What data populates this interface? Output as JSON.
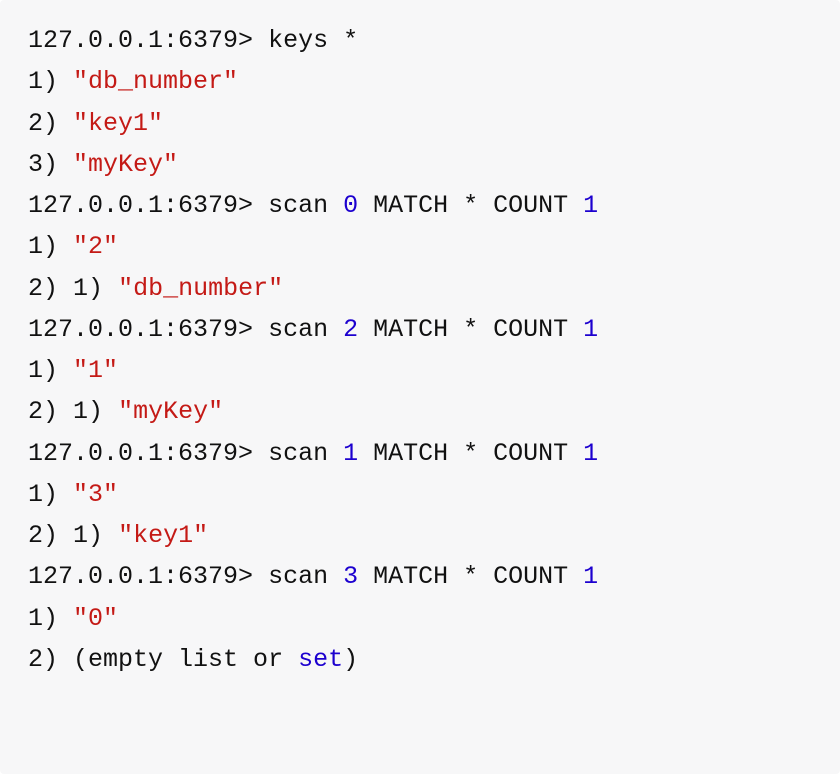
{
  "prompt": "127.0.0.1:6379>",
  "cmd_keys": "keys *",
  "keys_result": {
    "i1": "1)",
    "v1": "\"db_number\"",
    "i2": "2)",
    "v2": "\"key1\"",
    "i3": "3)",
    "v3": "\"myKey\""
  },
  "scan0": {
    "cmd_a": "scan ",
    "cmd_b": "0",
    "cmd_c": " MATCH * COUNT ",
    "cmd_d": "1",
    "r1i": "1)",
    "r1v": "\"2\"",
    "r2i": "2)",
    "r2j": "1)",
    "r2v": "\"db_number\""
  },
  "scan2": {
    "cmd_a": "scan ",
    "cmd_b": "2",
    "cmd_c": " MATCH * COUNT ",
    "cmd_d": "1",
    "r1i": "1)",
    "r1v": "\"1\"",
    "r2i": "2)",
    "r2j": "1)",
    "r2v": "\"myKey\""
  },
  "scan1": {
    "cmd_a": "scan ",
    "cmd_b": "1",
    "cmd_c": " MATCH * COUNT ",
    "cmd_d": "1",
    "r1i": "1)",
    "r1v": "\"3\"",
    "r2i": "2)",
    "r2j": "1)",
    "r2v": "\"key1\""
  },
  "scan3": {
    "cmd_a": "scan ",
    "cmd_b": "3",
    "cmd_c": " MATCH * COUNT ",
    "cmd_d": "1",
    "r1i": "1)",
    "r1v": "\"0\"",
    "r2i": "2)",
    "r2a": "(empty list or ",
    "r2b": "set",
    "r2c": ")"
  }
}
